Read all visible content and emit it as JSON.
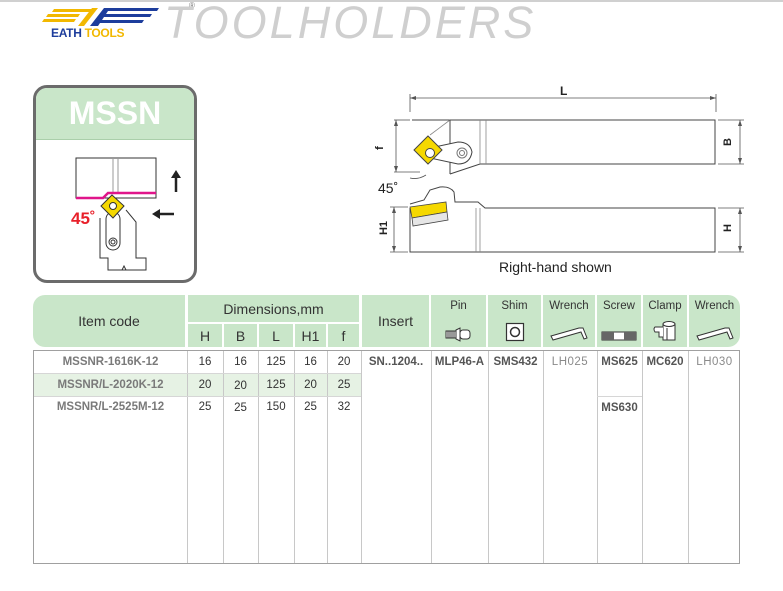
{
  "header": {
    "brand_left": "EATH",
    "brand_right": "TOOLS",
    "registered_mark": "®",
    "title": "TOOLHOLDERS"
  },
  "card": {
    "title": "MSSN",
    "approach_angle": "45˚"
  },
  "drawing": {
    "labels": {
      "L": "L",
      "B": "B",
      "f": "f",
      "H": "H",
      "H1": "H1",
      "angle": "45˚"
    },
    "caption": "Right-hand shown"
  },
  "table": {
    "headers": {
      "item_code": "Item code",
      "dimensions": "Dimensions,mm",
      "dim_cols": [
        "H",
        "B",
        "L",
        "H1",
        "f"
      ],
      "insert": "Insert",
      "parts": [
        {
          "label": "Pin",
          "icon": "pin-icon"
        },
        {
          "label": "Shim",
          "icon": "shim-icon"
        },
        {
          "label": "Wrench",
          "icon": "wrench-icon"
        },
        {
          "label": "Screw",
          "icon": "screw-icon"
        },
        {
          "label": "Clamp",
          "icon": "clamp-icon"
        },
        {
          "label": "Wrench",
          "icon": "wrench-icon"
        }
      ]
    },
    "rows": [
      {
        "code": "MSSNR-1616K-12",
        "H": "16",
        "B": "16",
        "L": "125",
        "H1": "16",
        "f": "20"
      },
      {
        "code": "MSSNR/L-2020K-12",
        "H": "20",
        "B": "20",
        "L": "125",
        "H1": "20",
        "f": "25"
      },
      {
        "code": "MSSNR/L-2525M-12",
        "H": "25",
        "B": "25",
        "L": "150",
        "H1": "25",
        "f": "32"
      }
    ],
    "shared": {
      "insert": "SN..1204..",
      "pin": "MLP46-A",
      "shim": "SMS432",
      "wrench1": "LH025",
      "screw_a": "MS625",
      "screw_b": "MS630",
      "clamp": "MC620",
      "wrench2": "LH030"
    },
    "colors": {
      "header_bg": "#c9e6c9",
      "highlight_row": "#e6f2e4",
      "insert_yellow": "#f5d800",
      "cut_line": "#e0158a",
      "angle_red": "#e8202a"
    }
  }
}
